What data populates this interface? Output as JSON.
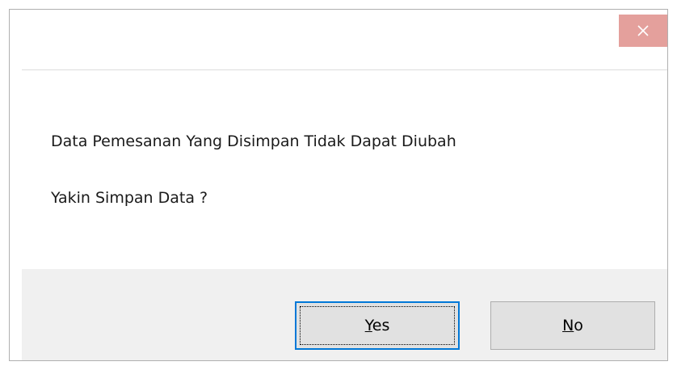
{
  "dialog": {
    "close_icon": "close-icon",
    "message_line1": "Data Pemesanan Yang Disimpan Tidak Dapat Diubah",
    "message_line2": "Yakin Simpan Data ?",
    "buttons": {
      "yes": {
        "accel": "Y",
        "rest": "es"
      },
      "no": {
        "accel": "N",
        "rest": "o"
      }
    }
  },
  "colors": {
    "close_bg": "#e4a09c",
    "focus_border": "#0078d7",
    "footer_bg": "#f0f0f0"
  }
}
